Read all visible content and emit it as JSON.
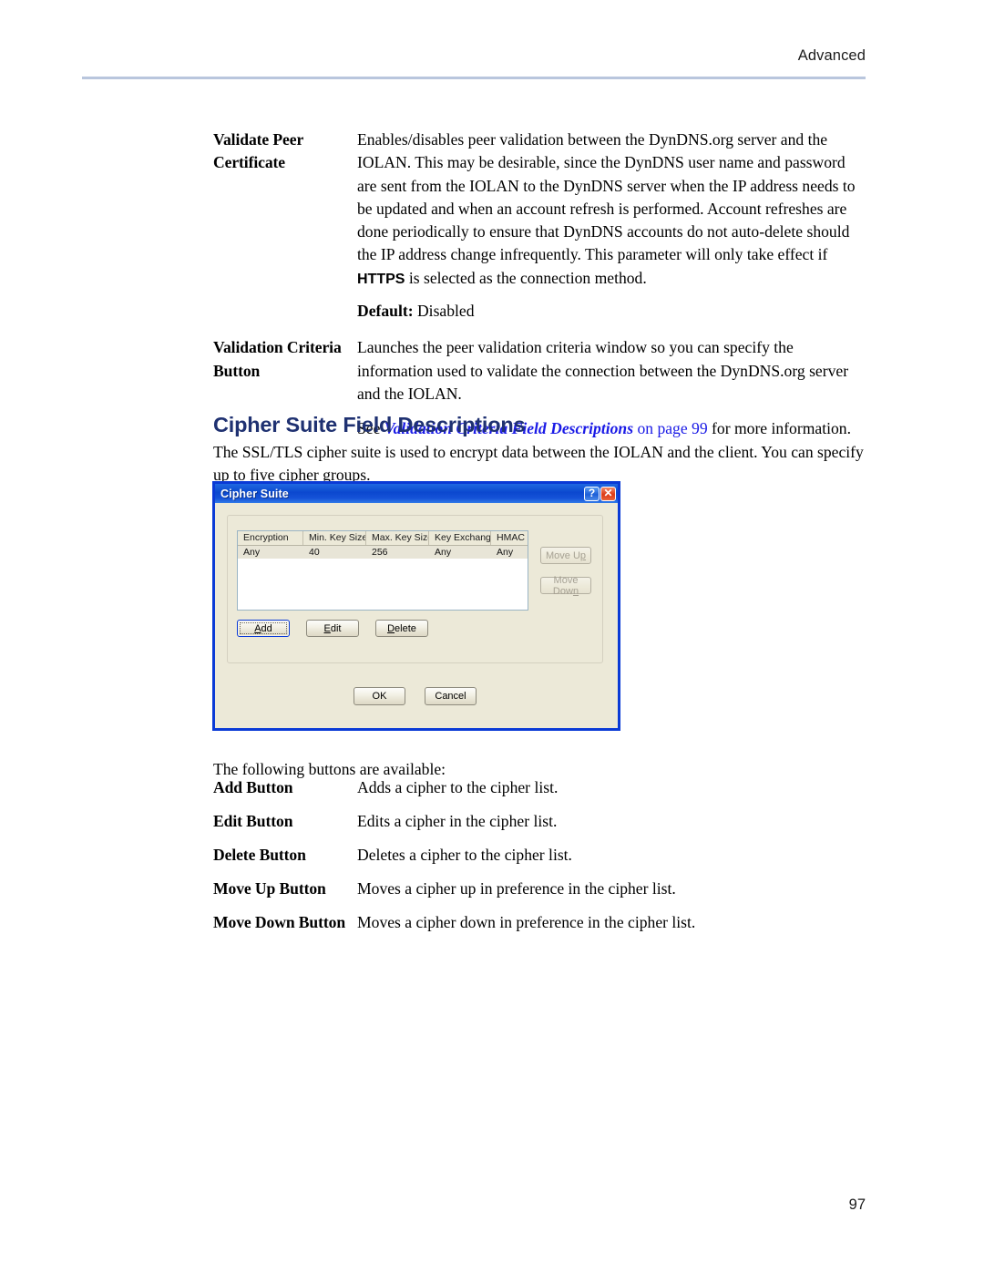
{
  "header": {
    "running_head": "Advanced"
  },
  "field_descriptions": [
    {
      "label_lines": [
        "Validate Peer",
        "Certificate"
      ],
      "body_before": "Enables/disables peer validation between the DynDNS.org server and the IOLAN. This may be desirable, since the DynDNS user name and password are sent from the IOLAN to the DynDNS server when the IP address needs to be updated and when an account refresh is performed. Account refreshes are done periodically to ensure that DynDNS accounts do not auto-delete should the IP address change infrequently. This parameter will only take effect if ",
      "body_emphasis": "HTTPS",
      "body_after": " is selected as the connection method.",
      "default_label": "Default:",
      "default_value": "Disabled"
    },
    {
      "label_lines": [
        "Validation Criteria",
        "Button"
      ],
      "body": "Launches the peer validation criteria window so you can specify the information used to validate the connection between the DynDNS.org server and the IOLAN.",
      "xref_prefix": "See ",
      "xref_title": "Validation Criteria Field Descriptions",
      "xref_page": " on page 99",
      "xref_suffix": " for more information."
    }
  ],
  "section": {
    "heading": "Cipher Suite Field Descriptions",
    "intro": "The SSL/TLS cipher suite is used to encrypt data between the IOLAN and the client. You can specify up to five cipher groups."
  },
  "dialog": {
    "title": "Cipher Suite",
    "titlebar_buttons": [
      {
        "name": "help-button",
        "glyph": "?"
      },
      {
        "name": "close-button",
        "glyph": "✕"
      }
    ],
    "table": {
      "columns": [
        "Encryption",
        "Min. Key Size",
        "Max. Key Size",
        "Key Exchange",
        "HMAC"
      ],
      "rows": [
        [
          "Any",
          "40",
          "256",
          "Any",
          "Any"
        ]
      ]
    },
    "buttons": {
      "move_up": {
        "label": "Move Up",
        "mnemonic_before": "Move U",
        "mnemonic": "p",
        "mnemonic_after": "",
        "enabled": false
      },
      "move_down": {
        "label": "Move Down",
        "mnemonic_before": "Move Dow",
        "mnemonic": "n",
        "mnemonic_after": "",
        "enabled": false
      },
      "add": {
        "label": "Add",
        "mnemonic_before": "",
        "mnemonic": "A",
        "mnemonic_after": "dd",
        "enabled": true,
        "focused": true
      },
      "edit": {
        "label": "Edit",
        "mnemonic_before": "",
        "mnemonic": "E",
        "mnemonic_after": "dit",
        "enabled": true
      },
      "delete": {
        "label": "Delete",
        "mnemonic_before": "",
        "mnemonic": "D",
        "mnemonic_after": "elete",
        "enabled": true
      },
      "ok": {
        "label": "OK",
        "enabled": true
      },
      "cancel": {
        "label": "Cancel",
        "enabled": true
      }
    }
  },
  "after_dialog": {
    "intro": "The following buttons are available:"
  },
  "button_descriptions": [
    {
      "label": "Add Button",
      "description": "Adds a cipher to the cipher list."
    },
    {
      "label": "Edit Button",
      "description": "Edits a cipher in the cipher list."
    },
    {
      "label": "Delete Button",
      "description": "Deletes a cipher to the cipher list."
    },
    {
      "label": "Move Up Button",
      "description": "Moves a cipher up in preference in the cipher list."
    },
    {
      "label": "Move Down Button",
      "description": "Moves a cipher down in preference in the cipher list."
    }
  ],
  "footer": {
    "page_number": "97"
  },
  "colors": {
    "heading": "#1f3171",
    "link": "#1a1ae6",
    "rule": "#b9c6dd",
    "dialog_face": "#ece9d8",
    "dialog_border": "#0a3ad6",
    "titlebar": "#0b48cf"
  }
}
